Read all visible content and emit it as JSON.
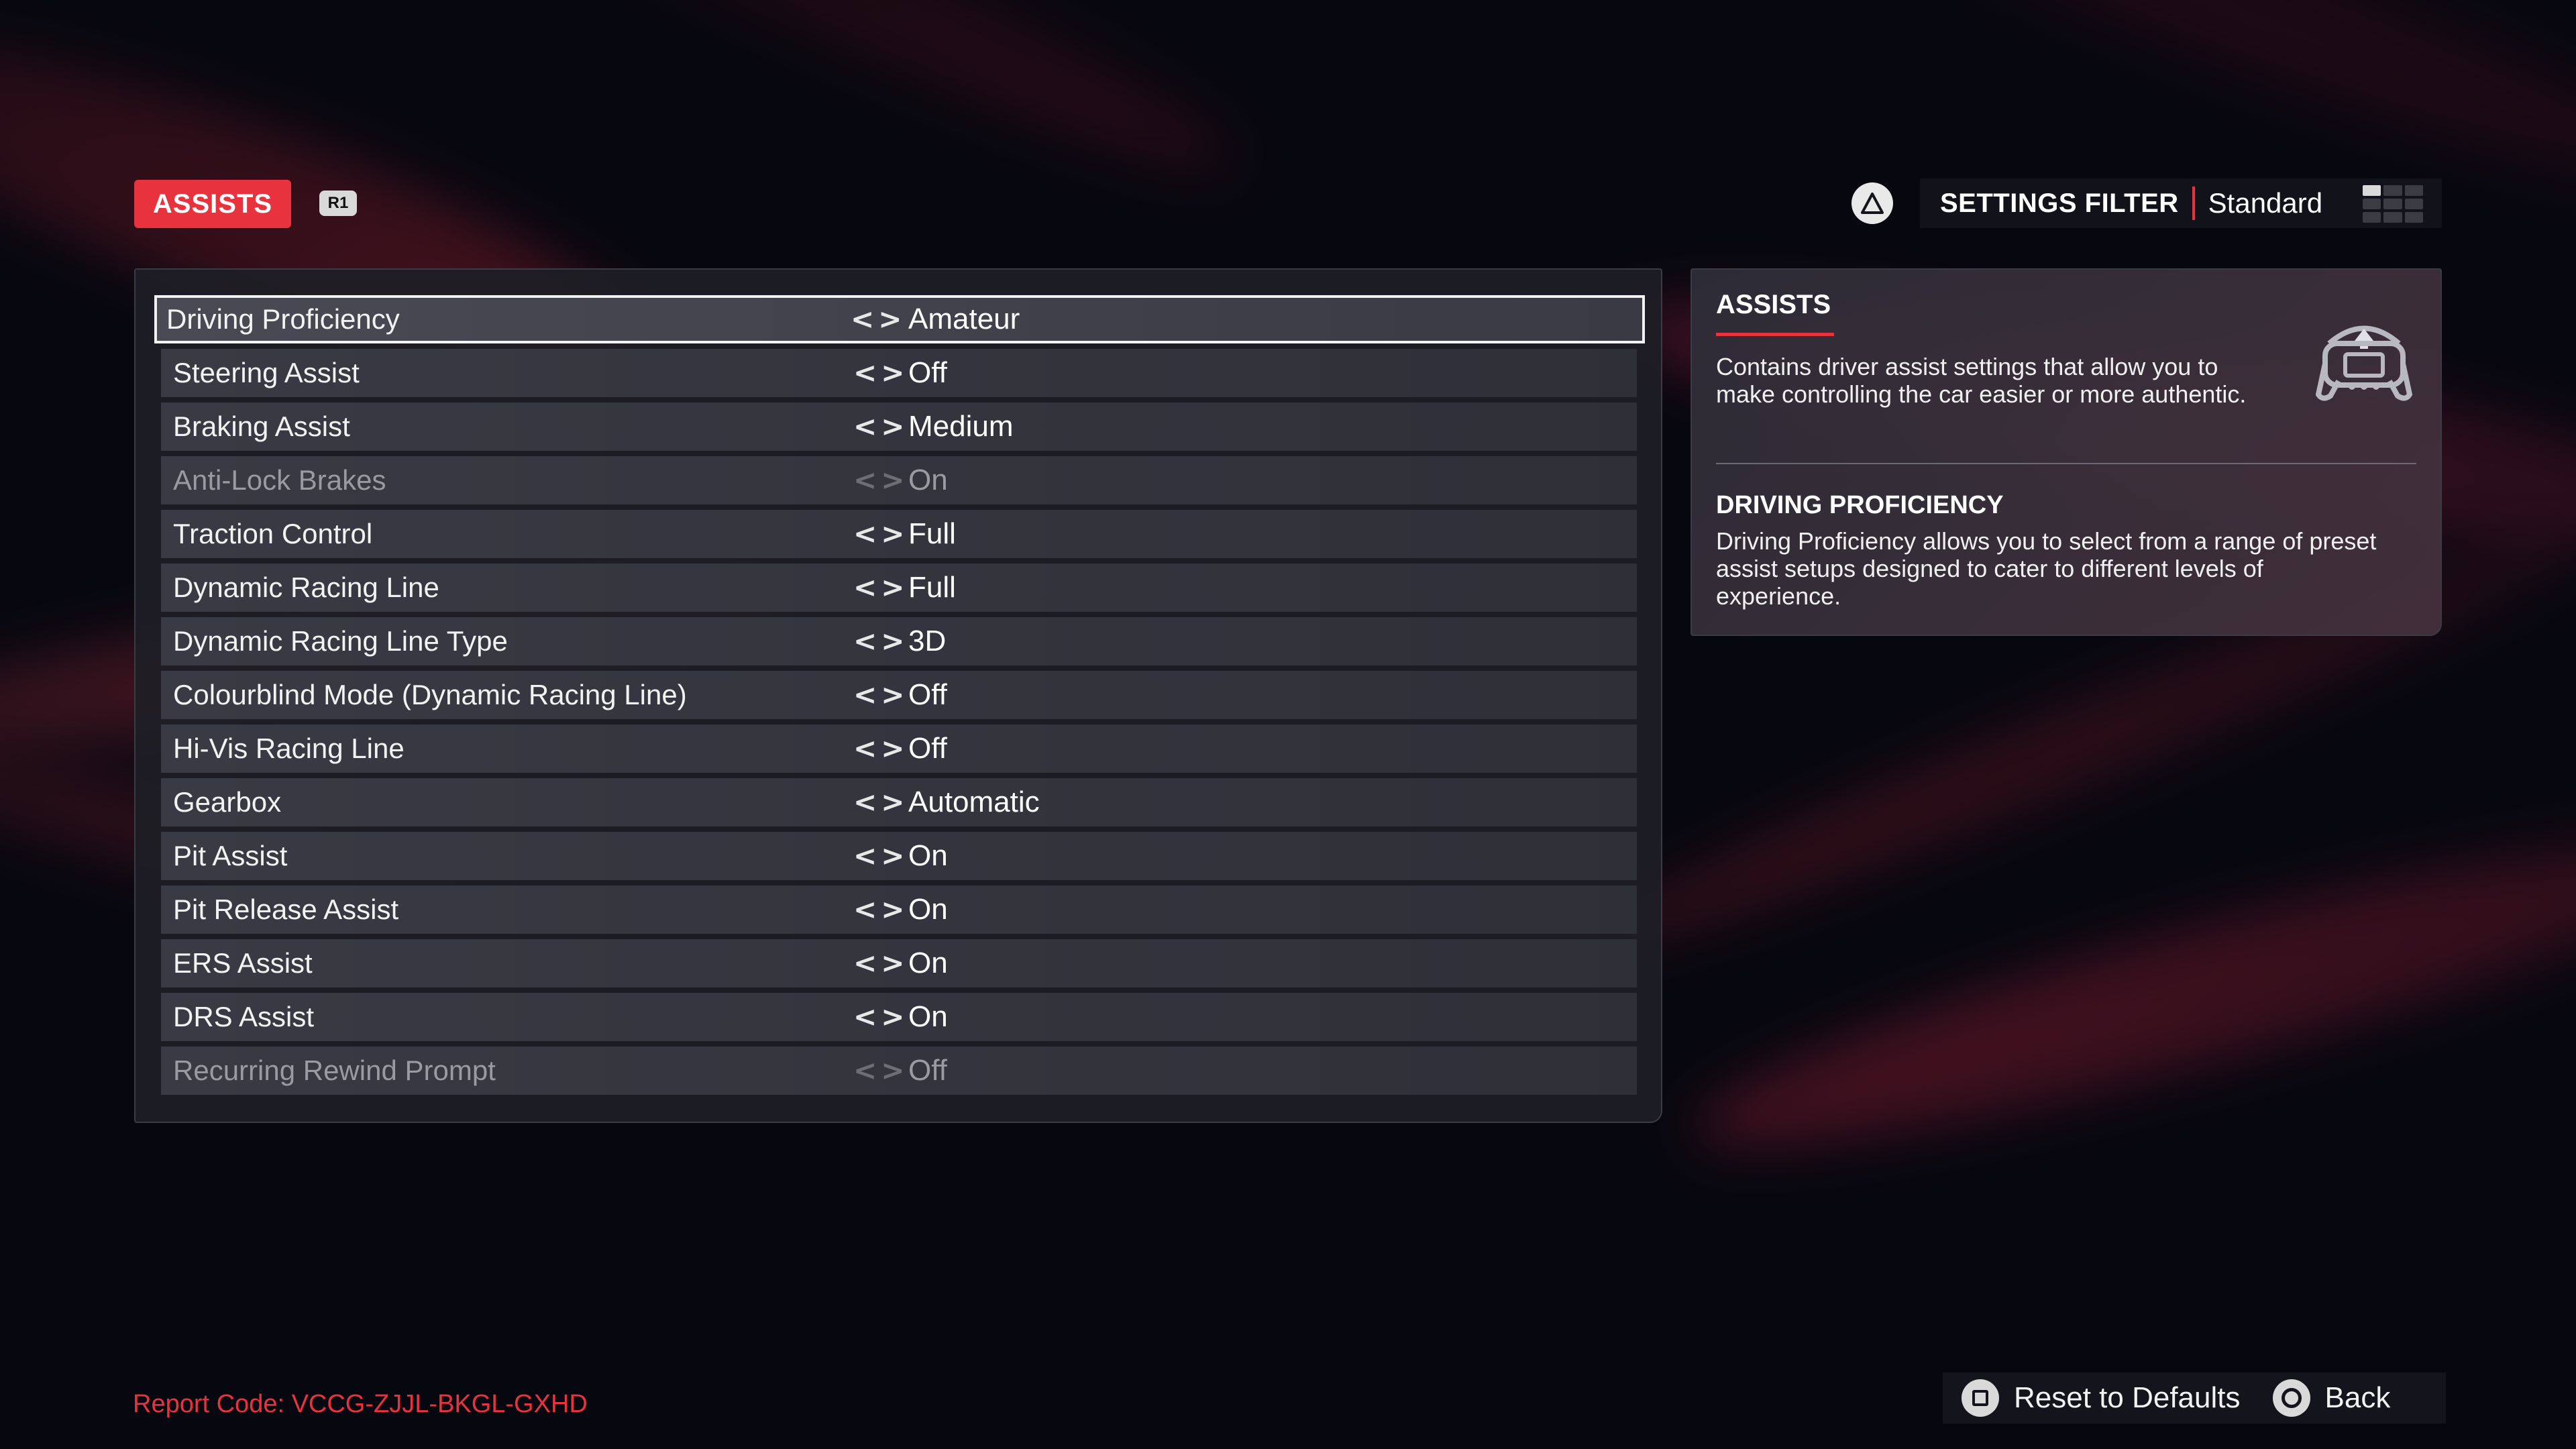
{
  "header": {
    "tab_label": "ASSISTS",
    "tab_shortcut": "R1",
    "filter_button_icon": "triangle-icon",
    "filter_label": "SETTINGS FILTER",
    "filter_value": "Standard"
  },
  "settings": [
    {
      "label": "Driving Proficiency",
      "value": "Amateur",
      "selected": true,
      "enabled": true
    },
    {
      "label": "Steering Assist",
      "value": "Off",
      "selected": false,
      "enabled": true
    },
    {
      "label": "Braking Assist",
      "value": "Medium",
      "selected": false,
      "enabled": true
    },
    {
      "label": "Anti-Lock Brakes",
      "value": "On",
      "selected": false,
      "enabled": false
    },
    {
      "label": "Traction Control",
      "value": "Full",
      "selected": false,
      "enabled": true
    },
    {
      "label": "Dynamic Racing Line",
      "value": "Full",
      "selected": false,
      "enabled": true
    },
    {
      "label": "Dynamic Racing Line Type",
      "value": "3D",
      "selected": false,
      "enabled": true
    },
    {
      "label": "Colourblind Mode (Dynamic Racing Line)",
      "value": "Off",
      "selected": false,
      "enabled": true
    },
    {
      "label": "Hi-Vis Racing Line",
      "value": "Off",
      "selected": false,
      "enabled": true
    },
    {
      "label": "Gearbox",
      "value": "Automatic",
      "selected": false,
      "enabled": true
    },
    {
      "label": "Pit Assist",
      "value": "On",
      "selected": false,
      "enabled": true
    },
    {
      "label": "Pit Release Assist",
      "value": "On",
      "selected": false,
      "enabled": true
    },
    {
      "label": "ERS Assist",
      "value": "On",
      "selected": false,
      "enabled": true
    },
    {
      "label": "DRS Assist",
      "value": "On",
      "selected": false,
      "enabled": true
    },
    {
      "label": "Recurring Rewind Prompt",
      "value": "Off",
      "selected": false,
      "enabled": false
    }
  ],
  "chevron_left": "<",
  "chevron_right": ">",
  "info": {
    "title": "ASSISTS",
    "description": "Contains driver assist settings that allow you to make controlling the car easier or more authentic.",
    "icon": "steering-wheel-icon",
    "detail_title": "DRIVING PROFICIENCY",
    "detail_description": "Driving Proficiency allows you to select from a range of preset assist setups designed to cater to different levels of experience."
  },
  "footer": {
    "report_code": "Report Code: VCCG-ZJJL-BKGL-GXHD",
    "reset_label": "Reset to Defaults",
    "reset_icon": "square-button-icon",
    "back_label": "Back",
    "back_icon": "circle-button-icon"
  },
  "colors": {
    "accent": "#e8333f",
    "background": "#07070f",
    "panel": "#1e1e26",
    "row": "#3a3a44"
  }
}
